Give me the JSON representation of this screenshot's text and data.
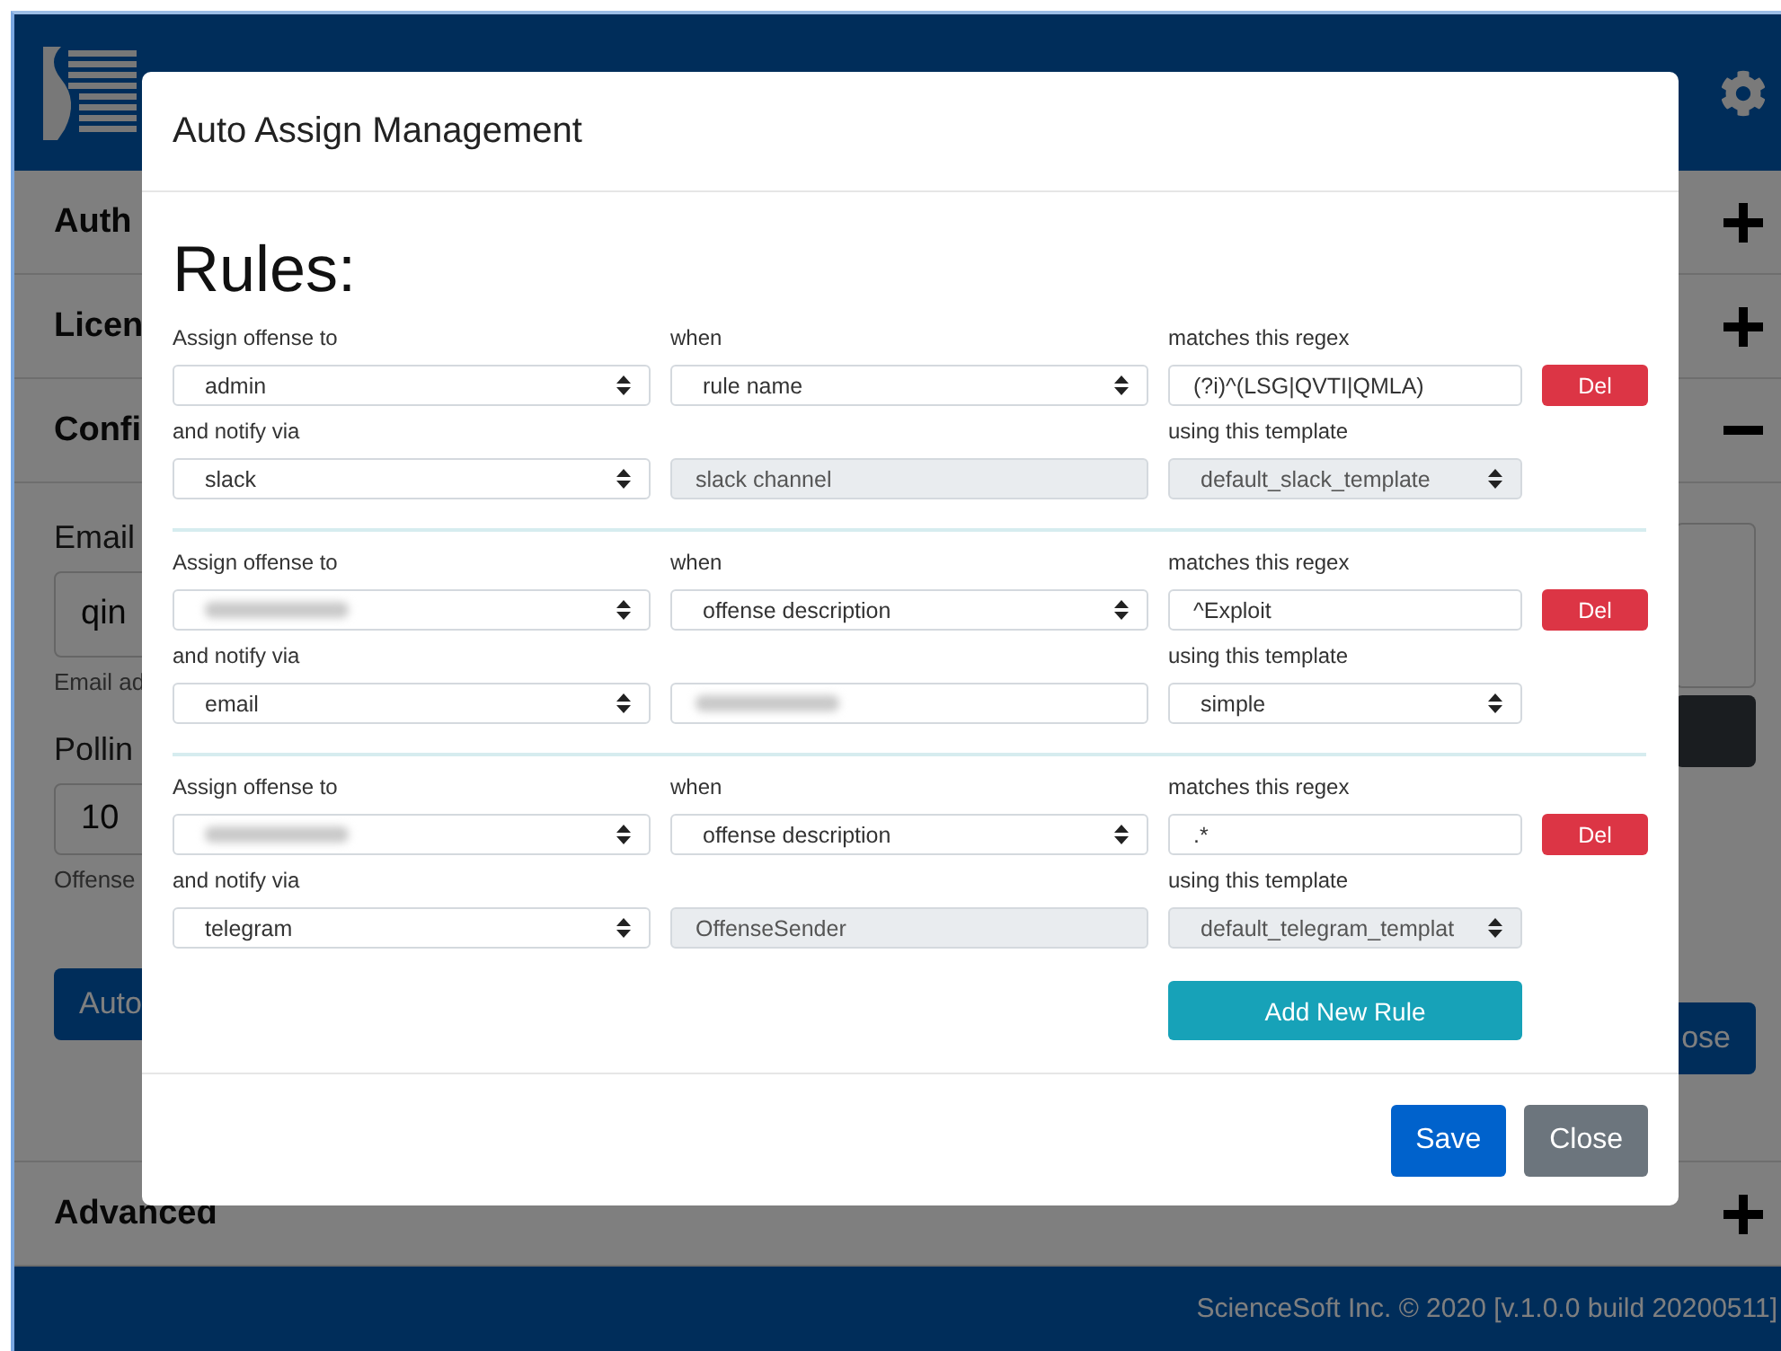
{
  "sections": [
    {
      "title": "Auth",
      "expanded": false
    },
    {
      "title": "Licen",
      "expanded": false
    },
    {
      "title": "Confi",
      "expanded": true,
      "body": {
        "fields": [
          {
            "label": "Email",
            "value": "qin",
            "help": "Email ad"
          },
          {
            "label": "Pollin",
            "value": "10",
            "help": "Offense"
          }
        ],
        "left_button": "Auto",
        "right_button": "ose"
      }
    },
    {
      "title": "Advanced",
      "expanded": false
    }
  ],
  "footer": "ScienceSoft Inc. © 2020 [v.1.0.0 build 20200511]",
  "modal": {
    "title": "Auto Assign Management",
    "heading": "Rules:",
    "rules": [
      {
        "fields": [
          {
            "label": "Assign offense to",
            "kind": "select",
            "value": "admin",
            "redacted": false,
            "disabled": false
          },
          {
            "label": "when",
            "kind": "select",
            "value": "rule name",
            "redacted": false,
            "disabled": false
          },
          {
            "label": "matches this regex",
            "kind": "input",
            "value": "(?i)^(LSG|QVTI|QMLA)",
            "redacted": false,
            "disabled": false
          },
          {
            "label": "and notify via",
            "kind": "select",
            "value": "slack",
            "redacted": false,
            "disabled": false
          },
          {
            "kind": "input",
            "value": "slack channel",
            "redacted": false,
            "disabled": true
          },
          {
            "label": "using this template",
            "kind": "select",
            "value": "default_slack_template",
            "redacted": false,
            "disabled": true
          }
        ],
        "delete_button": "Del"
      },
      {
        "fields": [
          {
            "label": "Assign offense to",
            "kind": "select",
            "redacted": true,
            "disabled": false
          },
          {
            "label": "when",
            "kind": "select",
            "value": "offense description",
            "redacted": false,
            "disabled": false
          },
          {
            "label": "matches this regex",
            "kind": "input",
            "value": "^Exploit",
            "redacted": false,
            "disabled": false
          },
          {
            "label": "and notify via",
            "kind": "select",
            "value": "email",
            "redacted": false,
            "disabled": false
          },
          {
            "kind": "input",
            "redacted": true,
            "disabled": false
          },
          {
            "label": "using this template",
            "kind": "select",
            "value": "simple",
            "redacted": false,
            "disabled": false
          }
        ],
        "delete_button": "Del"
      },
      {
        "fields": [
          {
            "label": "Assign offense to",
            "kind": "select",
            "redacted": true,
            "disabled": false
          },
          {
            "label": "when",
            "kind": "select",
            "value": "offense description",
            "redacted": false,
            "disabled": false
          },
          {
            "label": "matches this regex",
            "kind": "input",
            "value": ".*",
            "redacted": false,
            "disabled": false
          },
          {
            "label": "and notify via",
            "kind": "select",
            "value": "telegram",
            "redacted": false,
            "disabled": false
          },
          {
            "kind": "input",
            "value": "OffenseSender",
            "redacted": false,
            "disabled": true
          },
          {
            "label": "using this template",
            "kind": "select",
            "value": "default_telegram_templat",
            "redacted": false,
            "disabled": true
          }
        ],
        "delete_button": "Del"
      }
    ],
    "add_button": "Add New Rule",
    "footer_buttons": [
      {
        "label": "Save",
        "kind": "primary"
      },
      {
        "label": "Close",
        "kind": "secondary"
      }
    ]
  }
}
